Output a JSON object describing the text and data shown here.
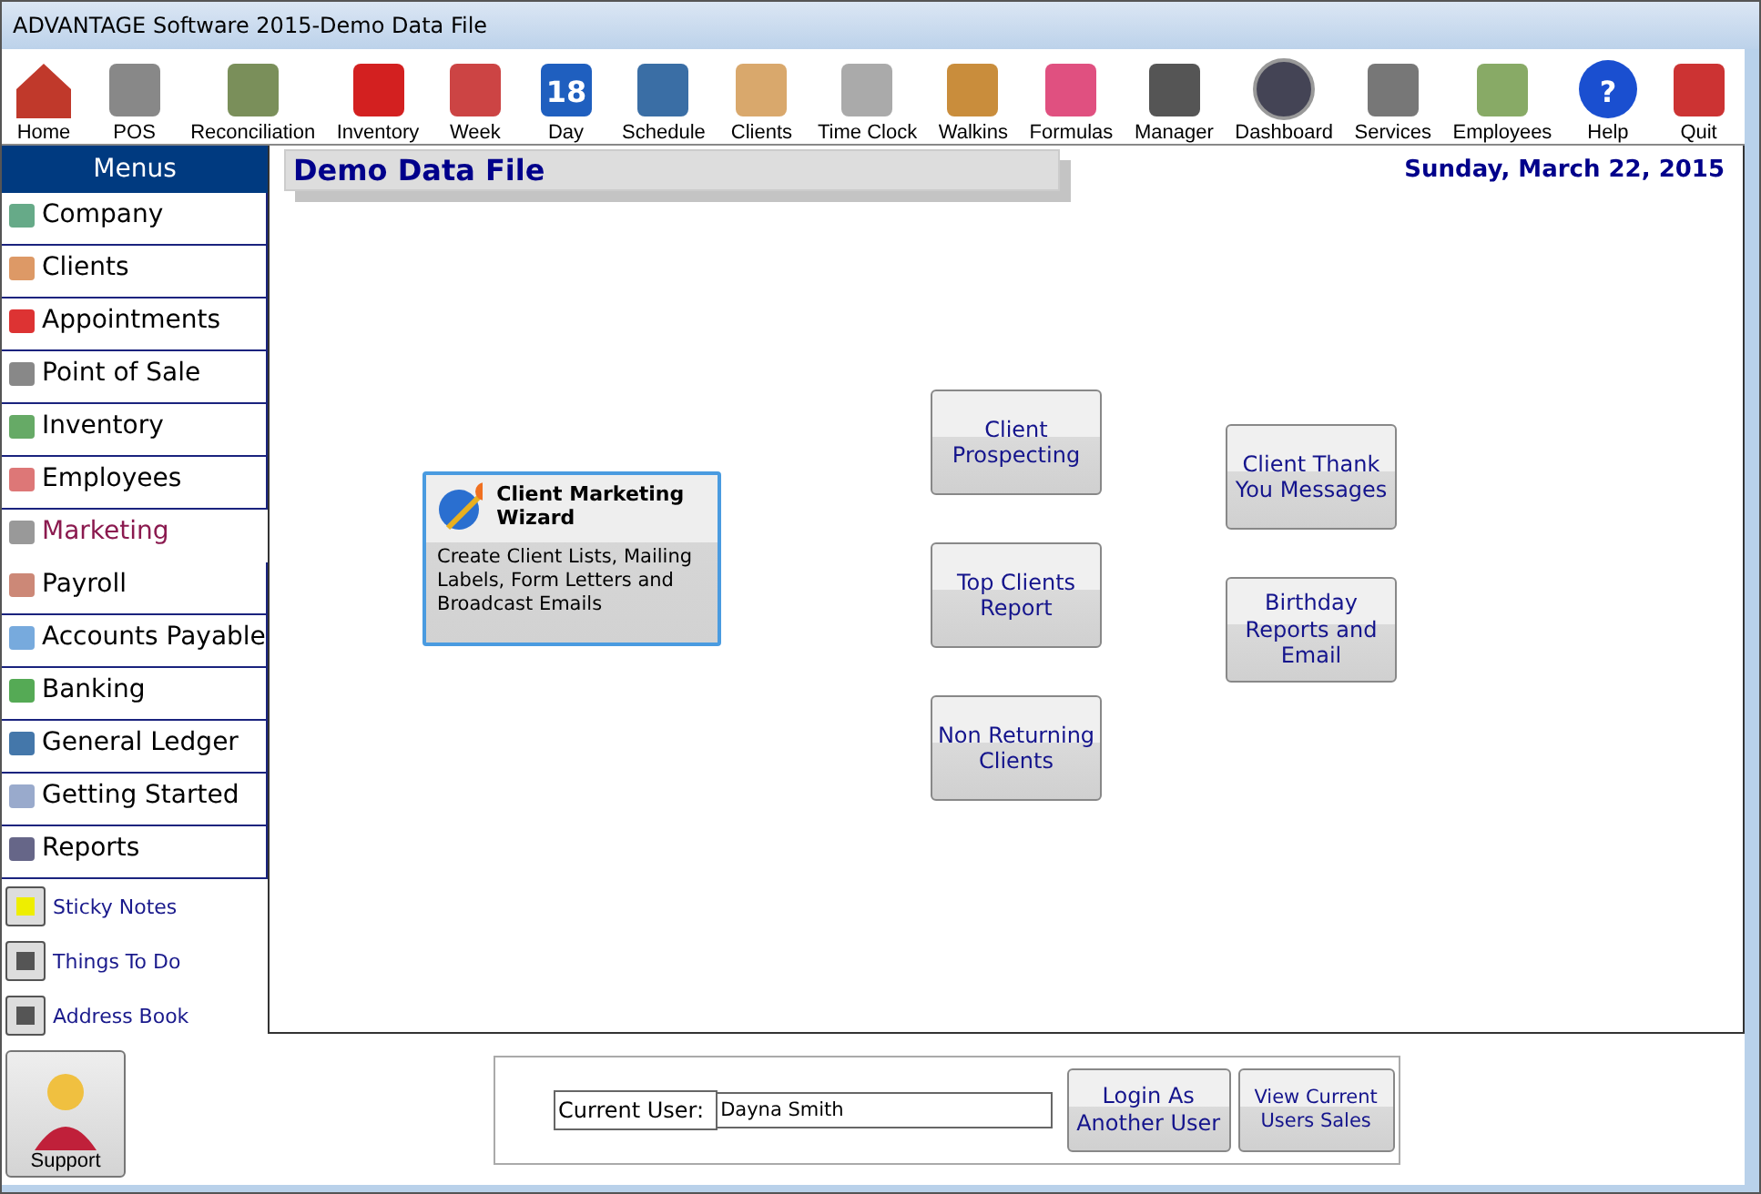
{
  "window": {
    "title": "ADVANTAGE Software 2015-Demo Data File"
  },
  "toolbar": [
    {
      "label": "Home"
    },
    {
      "label": "POS"
    },
    {
      "label": "Reconciliation"
    },
    {
      "label": "Inventory"
    },
    {
      "label": "Week"
    },
    {
      "label": "Day",
      "icon_text": "18"
    },
    {
      "label": "Schedule"
    },
    {
      "label": "Clients"
    },
    {
      "label": "Time Clock"
    },
    {
      "label": "Walkins"
    },
    {
      "label": "Formulas"
    },
    {
      "label": "Manager"
    },
    {
      "label": "Dashboard"
    },
    {
      "label": "Services"
    },
    {
      "label": "Employees"
    },
    {
      "label": "Help",
      "icon_text": "?"
    },
    {
      "label": "Quit"
    }
  ],
  "sidebar": {
    "title": "Menus",
    "items": [
      {
        "label": "Company",
        "selected": false
      },
      {
        "label": "Clients",
        "selected": false
      },
      {
        "label": "Appointments",
        "selected": false
      },
      {
        "label": "Point of Sale",
        "selected": false
      },
      {
        "label": "Inventory",
        "selected": false
      },
      {
        "label": "Employees",
        "selected": false
      },
      {
        "label": "Marketing",
        "selected": true
      },
      {
        "label": "Payroll",
        "selected": false
      },
      {
        "label": "Accounts Payable",
        "selected": false
      },
      {
        "label": "Banking",
        "selected": false
      },
      {
        "label": "General Ledger",
        "selected": false
      },
      {
        "label": "Getting Started",
        "selected": false
      },
      {
        "label": "Reports",
        "selected": false
      }
    ],
    "links": [
      {
        "label": "Sticky Notes"
      },
      {
        "label": "Things To Do"
      },
      {
        "label": "Address Book"
      }
    ],
    "support": {
      "label": "Support"
    }
  },
  "main": {
    "title": "Demo Data File",
    "date": "Sunday, March 22, 2015",
    "wizard": {
      "title": "Client Marketing Wizard",
      "description": "Create Client Lists, Mailing Labels, Form Letters and Broadcast Emails"
    },
    "middle_buttons": [
      "Client Prospecting",
      "Top Clients Report",
      "Non Returning Clients"
    ],
    "right_buttons": [
      "Client Thank You Messages",
      "Birthday Reports and Email"
    ]
  },
  "footer": {
    "user_label": "Current User:",
    "user_value": "Dayna Smith",
    "buttons": [
      "Login As Another User",
      "View Current Users Sales"
    ]
  }
}
